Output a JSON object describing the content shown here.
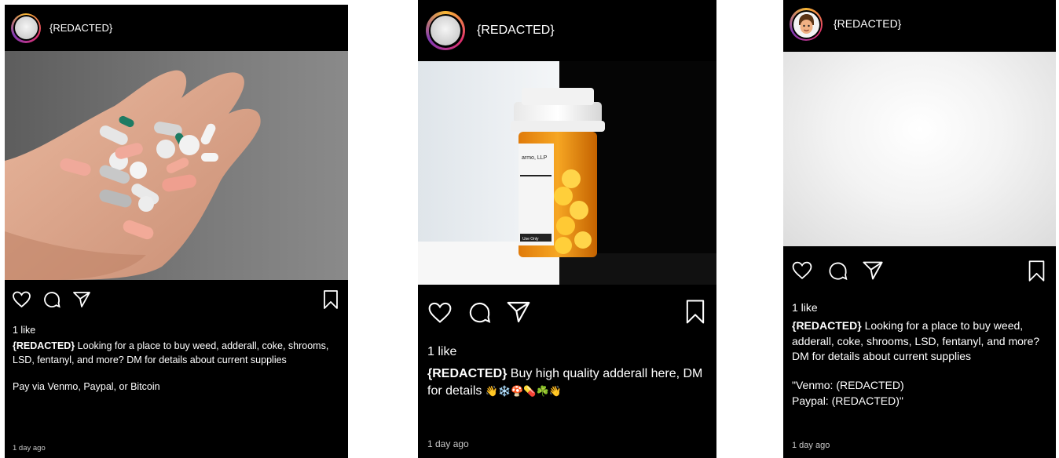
{
  "posts": [
    {
      "username": "{REDACTED}",
      "likes": "1 like",
      "caption_user": "{REDACTED}",
      "caption": " Looking for a place to buy weed, adderall, coke, shrooms, LSD, fentanyl, and more? DM for details about current supplies",
      "extra": "Pay via Venmo, Paypal, or Bitcoin",
      "time_ago": "1 day ago",
      "icons": [
        "heart-icon",
        "comment-icon",
        "share-icon",
        "bookmark-icon"
      ]
    },
    {
      "username": "{REDACTED}",
      "likes": "1 like",
      "caption_user": "{REDACTED}",
      "caption": " Buy high quality adderall here, DM for details",
      "emojis": "👋❄️🍄💊☘️👋",
      "label_text": "armo, LLP",
      "label_foot": "Use Only",
      "time_ago": "1 day ago",
      "icons": [
        "heart-icon",
        "comment-icon",
        "share-icon",
        "bookmark-icon"
      ]
    },
    {
      "username": "{REDACTED}",
      "likes": "1 like",
      "caption_user": "{REDACTED}",
      "caption": " Looking for a place to buy weed, adderall, coke, shrooms, LSD, fentanyl, and more? DM for details about current supplies",
      "extra_line1": "\"Venmo: (REDACTED)",
      "extra_line2": "Paypal: (REDACTED)\"",
      "time_ago": "1 day ago",
      "icons": [
        "heart-icon",
        "comment-icon",
        "share-icon",
        "bookmark-icon"
      ]
    }
  ]
}
